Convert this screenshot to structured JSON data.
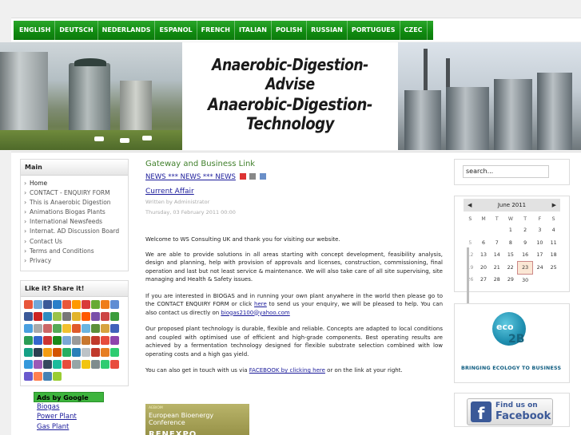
{
  "languages": [
    "ENGLISH",
    "DEUTSCH",
    "NEDERLANDS",
    "ESPANOL",
    "FRENCH",
    "ITALIAN",
    "POLISH",
    "RUSSIAN",
    "PORTUGUES",
    "CZEC"
  ],
  "header": {
    "line1": "Anaerobic-Digestion-Advise",
    "line2": "Anaerobic-Digestion-Technology"
  },
  "menu": {
    "title": "Main",
    "items": [
      "Home",
      "CONTACT - ENQUIRY FORM",
      "This is Anaerobic Digestion",
      "Animations Biogas Plants",
      "International Newsfeeds",
      "Internat. AD Discussion Board",
      "Contact Us",
      "Terms and Conditions",
      "Privacy"
    ]
  },
  "share": {
    "title": "Like it? Share it!",
    "icon_colors": [
      "#e8563a",
      "#6fa7d8",
      "#3b5998",
      "#2a7fc9",
      "#e8563a",
      "#ff9900",
      "#d93b3b",
      "#66aa33",
      "#ef7d1a",
      "#5f8dd3",
      "#3b5998",
      "#cc2222",
      "#2e8bc0",
      "#9ac34a",
      "#777777",
      "#e2b42b",
      "#ff5a00",
      "#7a4ea8",
      "#c44",
      "#3b9c3b",
      "#4aa0e0",
      "#aaaaaa",
      "#cc6666",
      "#55aa55",
      "#f2c12e",
      "#e05a2b",
      "#6bb5e0",
      "#5b8f3a",
      "#d7a33f",
      "#4062bb",
      "#2a9d55",
      "#3366cc",
      "#cc3333",
      "#1a8a1a",
      "#7aa7d6",
      "#999999",
      "#c9772e",
      "#c0392b",
      "#e74c3c",
      "#8e44ad",
      "#16a085",
      "#2c3e50",
      "#f39c12",
      "#d35400",
      "#27ae60",
      "#2980b9",
      "#bdc3c7",
      "#c0392b",
      "#e67e22",
      "#2ecc71",
      "#3498db",
      "#9b59b6",
      "#34495e",
      "#1abc9c",
      "#e74c3c",
      "#95a5a6",
      "#f1c40f",
      "#7f8c8d",
      "#2ecc71",
      "#e84c3d",
      "#6a5acd",
      "#ff7f50",
      "#4682b4",
      "#9acd32"
    ]
  },
  "ads": {
    "title": "Ads by Google",
    "links": [
      "Biogas",
      "Power Plant",
      "Gas Plant"
    ]
  },
  "article": {
    "section_title": "Gateway and Business Link",
    "news": "NEWS *** NEWS *** NEWS",
    "title": "Current Affair",
    "author": "Written by Administrator",
    "date": "Thursday, 03 February 2011 00:00",
    "p1": "Welcome to WS Consulting UK and thank you for visiting our website.",
    "p2": "We are able to provide solutions in all areas starting with concept development, feasibility analysis, design and planning, help with provision of approvals and licenses, construction, commissioning, final operation and last but not least service & maintenance. We will also take care of all site supervising, site managing and Health & Safety issues.",
    "p3_a": "If you are interested in BIOGAS and in running your own plant anywhere in the world then please go to the CONTACT ENQUIRY FORM or click ",
    "p3_link": "here",
    "p3_b": " to send us your enquiry, we will be pleased to help. You can also contact us directly on ",
    "p3_email": "biogas2100@yahoo.com",
    "p4": "Our proposed plant technology is durable, flexible and reliable. Concepts are adapted to local conditions and coupled with optimised use of efficient and high-grade components. Best operating results are achieved by a fermentation technology designed for flexible substrate selection combined with low operating costs and a high gas yield.",
    "p5_a": "You can also get in touch with us via ",
    "p5_link": "FACEBOOK by clicking here",
    "p5_b": " or on the link at your right.",
    "banner_small": "AEBIOM",
    "banner_title": "European Bioenergy Conference",
    "banner_brand": "RENEXPO"
  },
  "search": {
    "value": "search..."
  },
  "calendar": {
    "month": "June 2011",
    "prev": "◀",
    "next": "▶",
    "days": [
      "S",
      "M",
      "T",
      "W",
      "T",
      "F",
      "S"
    ],
    "weeks": [
      [
        "",
        "",
        "",
        "1",
        "2",
        "3",
        "4"
      ],
      [
        "5",
        "6",
        "7",
        "8",
        "9",
        "10",
        "11"
      ],
      [
        "12",
        "13",
        "14",
        "15",
        "16",
        "17",
        "18"
      ],
      [
        "19",
        "20",
        "21",
        "22",
        "23",
        "24",
        "25"
      ],
      [
        "26",
        "27",
        "28",
        "29",
        "30",
        "",
        ""
      ]
    ],
    "today": "23"
  },
  "eco": {
    "logo": "eco",
    "logo2": "2B",
    "caption": "BRINGING ECOLOGY TO BUSINESS"
  },
  "facebook": {
    "f": "f",
    "line1": "Find us on",
    "line2": "Facebook"
  }
}
